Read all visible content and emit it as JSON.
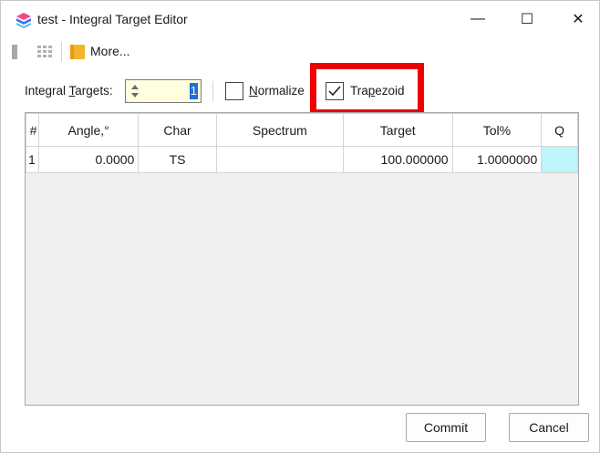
{
  "window": {
    "title": "test - Integral Target Editor",
    "controls": {
      "minimize": "—",
      "maximize": "☐",
      "close": "✕"
    }
  },
  "toolbar": {
    "more_label": "More..."
  },
  "options": {
    "integral_targets_prefix": "Integral ",
    "integral_targets_underline": "T",
    "integral_targets_suffix": "argets:",
    "integral_targets_value": "1",
    "normalize_underline": "N",
    "normalize_suffix": "ormalize",
    "normalize_checked": false,
    "trapezoid_prefix": "Tra",
    "trapezoid_underline": "p",
    "trapezoid_suffix": "ezoid",
    "trapezoid_checked": true,
    "checkmark": "✓"
  },
  "grid": {
    "columns": [
      "#",
      "Angle,°",
      "Char",
      "Spectrum",
      "Target",
      "Tol%",
      "Q"
    ],
    "rows": [
      {
        "num": "1",
        "angle": "0.0000",
        "char": "TS",
        "spectrum": "",
        "target": "100.000000",
        "tol": "1.0000000",
        "q": ""
      }
    ]
  },
  "buttons": {
    "commit": "Commit",
    "cancel": "Cancel"
  },
  "colors": {
    "highlight": "#ee0000",
    "q_cell": "#c0f4fb",
    "spin_bg": "#ffffe0",
    "selection": "#1f6fd4"
  }
}
